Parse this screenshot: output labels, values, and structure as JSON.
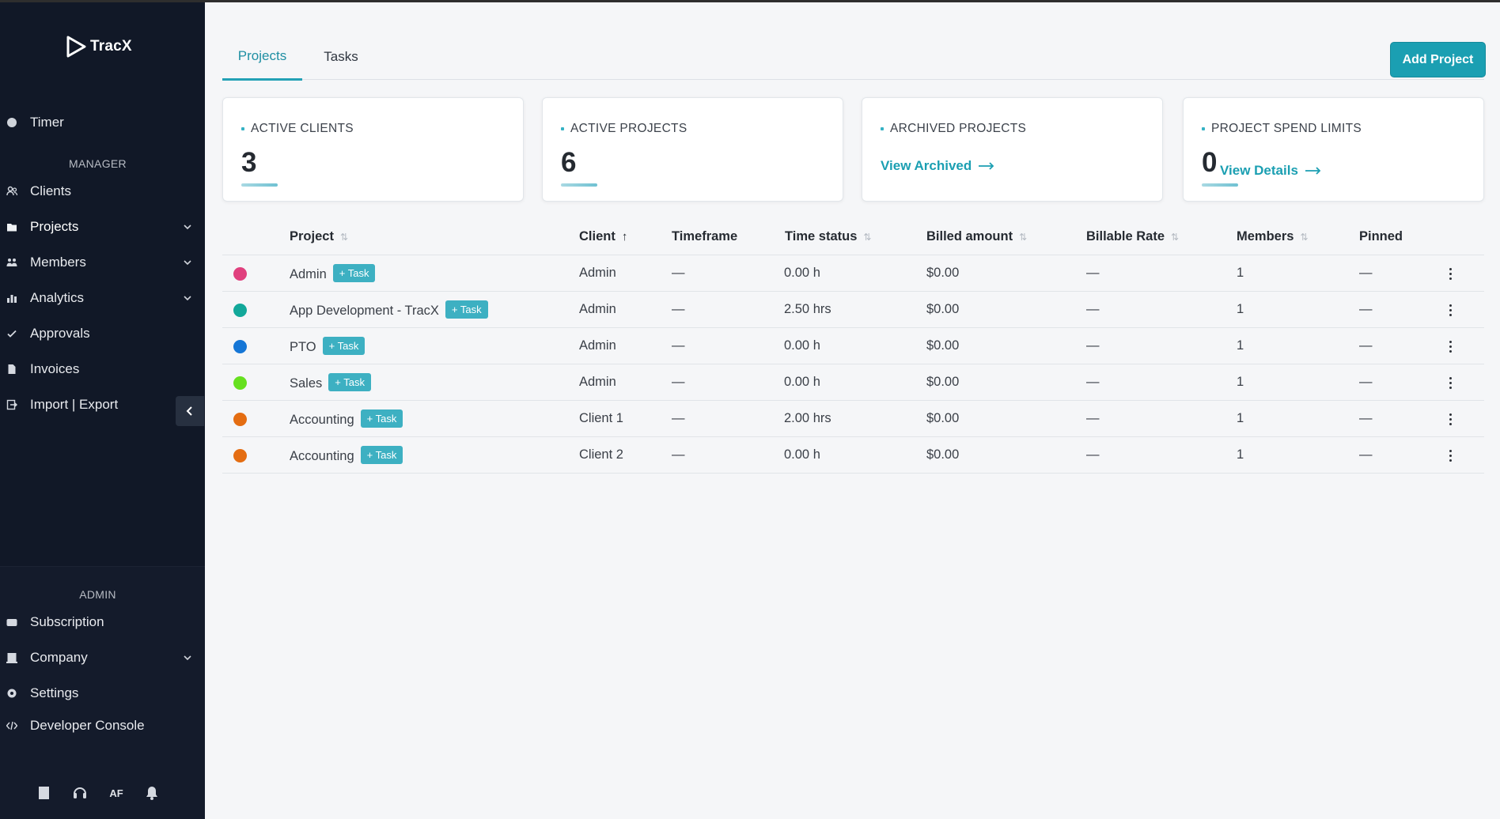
{
  "app": {
    "name": "TracX"
  },
  "sidebar": {
    "timer": {
      "label": "Timer"
    },
    "manager_label": "MANAGER",
    "manager_items": [
      {
        "label": "Clients",
        "icon": "users-icon",
        "chevron": false
      },
      {
        "label": "Projects",
        "icon": "folder-icon",
        "chevron": true,
        "active": true
      },
      {
        "label": "Members",
        "icon": "members-icon",
        "chevron": true
      },
      {
        "label": "Analytics",
        "icon": "chart-icon",
        "chevron": true
      },
      {
        "label": "Approvals",
        "icon": "check-icon",
        "chevron": false
      },
      {
        "label": "Invoices",
        "icon": "invoice-icon",
        "chevron": false
      },
      {
        "label": "Import | Export",
        "icon": "import-export-icon",
        "chevron": false
      }
    ],
    "admin_label": "ADMIN",
    "admin_items": [
      {
        "label": "Subscription",
        "icon": "card-icon",
        "chevron": false
      },
      {
        "label": "Company",
        "icon": "building-icon",
        "chevron": true
      },
      {
        "label": "Settings",
        "icon": "gear-icon",
        "chevron": false
      },
      {
        "label": "Developer Console",
        "icon": "code-icon",
        "chevron": false
      }
    ],
    "bottom": {
      "initials": "AF"
    }
  },
  "tabs": [
    {
      "label": "Projects",
      "active": true
    },
    {
      "label": "Tasks",
      "active": false
    }
  ],
  "add_project_label": "Add Project",
  "cards": {
    "active_clients": {
      "title": "ACTIVE CLIENTS",
      "value": "3"
    },
    "active_projects": {
      "title": "ACTIVE PROJECTS",
      "value": "6"
    },
    "archived_projects": {
      "title": "ARCHIVED PROJECTS",
      "link": "View Archived"
    },
    "spend_limits": {
      "title": "PROJECT SPEND LIMITS",
      "value": "0",
      "link": "View Details"
    }
  },
  "table": {
    "columns": {
      "project": "Project",
      "client": "Client",
      "timeframe": "Timeframe",
      "time_status": "Time status",
      "billed_amount": "Billed amount",
      "billable_rate": "Billable Rate",
      "members": "Members",
      "pinned": "Pinned"
    },
    "task_label": "+ Task",
    "rows": [
      {
        "color": "#e0407e",
        "project": "Admin",
        "client": "Admin",
        "timeframe": "—",
        "time_status": "0.00 h",
        "billed": "$0.00",
        "rate": "—",
        "members": "1",
        "pinned": "—"
      },
      {
        "color": "#12a89a",
        "project": "App Development - TracX",
        "client": "Admin",
        "timeframe": "—",
        "time_status": "2.50 hrs",
        "billed": "$0.00",
        "rate": "—",
        "members": "1",
        "pinned": "—"
      },
      {
        "color": "#1576d6",
        "project": "PTO",
        "client": "Admin",
        "timeframe": "—",
        "time_status": "0.00 h",
        "billed": "$0.00",
        "rate": "—",
        "members": "1",
        "pinned": "—"
      },
      {
        "color": "#66e01f",
        "project": "Sales",
        "client": "Admin",
        "timeframe": "—",
        "time_status": "0.00 h",
        "billed": "$0.00",
        "rate": "—",
        "members": "1",
        "pinned": "—"
      },
      {
        "color": "#e46d12",
        "project": "Accounting",
        "client": "Client 1",
        "timeframe": "—",
        "time_status": "2.00 hrs",
        "billed": "$0.00",
        "rate": "—",
        "members": "1",
        "pinned": "—"
      },
      {
        "color": "#e46d12",
        "project": "Accounting",
        "client": "Client 2",
        "timeframe": "—",
        "time_status": "0.00 h",
        "billed": "$0.00",
        "rate": "—",
        "members": "1",
        "pinned": "—"
      }
    ]
  }
}
